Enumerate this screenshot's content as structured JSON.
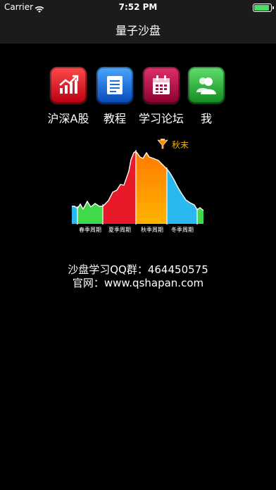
{
  "status_bar": {
    "carrier": "Carrier",
    "time": "7:52 PM",
    "battery_level": 0.9,
    "icons": [
      "wifi-icon",
      "battery-icon"
    ]
  },
  "nav": {
    "title": "量子沙盘"
  },
  "menu": [
    {
      "label": "沪深A股",
      "icon": "stock-chart-icon",
      "color": "#d0101c"
    },
    {
      "label": "教程",
      "icon": "document-icon",
      "color": "#1a6fe0"
    },
    {
      "label": "学习论坛",
      "icon": "calendar-icon",
      "color": "#b0104a"
    },
    {
      "label": "我",
      "icon": "users-icon",
      "color": "#2cb53a"
    }
  ],
  "cycle_chart": {
    "marker_label": "秋末",
    "seasons": [
      {
        "label": "春季周期",
        "color": "#3fd94a"
      },
      {
        "label": "夏季周期",
        "color": "#e81a2a"
      },
      {
        "label": "秋季周期",
        "color": "#ff8a00"
      },
      {
        "label": "冬季周期",
        "color": "#2ab8f0"
      }
    ]
  },
  "footer": {
    "qq_group": "沙盘学习QQ群：464450575",
    "website": "官网：www.qshapan.com"
  }
}
